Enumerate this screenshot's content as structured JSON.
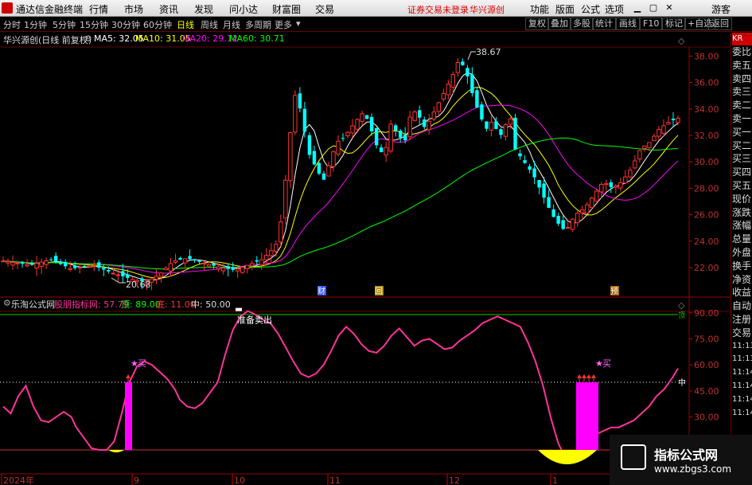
{
  "app": {
    "name": "通达信金融终端",
    "menu": [
      "行情",
      "市场",
      "资讯",
      "发现",
      "问小达",
      "财富圈",
      "交易"
    ],
    "warning": "证券交易未登录",
    "stock_short": "华兴源创",
    "right_menu": [
      "功能",
      "版面",
      "公式",
      "选项"
    ],
    "guest": "游客"
  },
  "toolbar": {
    "timeframes": [
      "分时",
      "1分钟",
      "5分钟",
      "15分钟",
      "30分钟",
      "60分钟",
      "日线",
      "周线",
      "月线",
      "多周期",
      "更多"
    ],
    "active_timeframe": "日线",
    "right_buttons": [
      "复权",
      "叠加",
      "多股",
      "统计",
      "画线",
      "F10",
      "标记",
      "+自选",
      "返回"
    ]
  },
  "main_chart": {
    "title": "华兴源创(日线 前复权)",
    "ma": [
      {
        "label": "MA5: 32.05",
        "color": "#ffffff"
      },
      {
        "label": "MA10: 31.05",
        "color": "#ffff00"
      },
      {
        "label": "MA20: 29.12",
        "color": "#ff00ff"
      },
      {
        "label": "MA60: 30.71",
        "color": "#00ff00"
      }
    ],
    "high_label": "38.67",
    "low_label": "20.68",
    "markers": [
      "财",
      "回",
      "预"
    ]
  },
  "indicator": {
    "name": "乐淘公式网",
    "title": "股朋指标网: 57.79",
    "top": "顶: 89.00",
    "bottom": "底: 11.00",
    "mid": "中: 50.00",
    "sell_label": "准备卖出",
    "buy_label": "买",
    "mid_tag": "中",
    "top_tag": "顶"
  },
  "axes": {
    "price_ticks": [
      "38.00",
      "36.00",
      "34.00",
      "32.00",
      "30.00",
      "28.00",
      "26.00",
      "24.00",
      "22.00"
    ],
    "ind_ticks": [
      "90.00",
      "75.00",
      "60.00",
      "45.00",
      "30.00"
    ],
    "date_labels": [
      "2024年",
      "9",
      "10",
      "11",
      "12",
      "1"
    ]
  },
  "right_panel": {
    "items": [
      "委比",
      "卖五",
      "卖四",
      "卖三",
      "卖二",
      "卖一",
      "买一",
      "买二",
      "买三",
      "买四",
      "买五",
      "现价",
      "涨跌",
      "涨幅",
      "总量",
      "外盘",
      "换手",
      "净资",
      "收益",
      "自动",
      "注册",
      "交易",
      "11:13",
      "11:13",
      "11:14",
      "11:14",
      "11:14",
      "11:14"
    ],
    "badge": "KR"
  },
  "watermark": {
    "title": "指标公式网",
    "url": "www.zbgs3.com"
  }
}
